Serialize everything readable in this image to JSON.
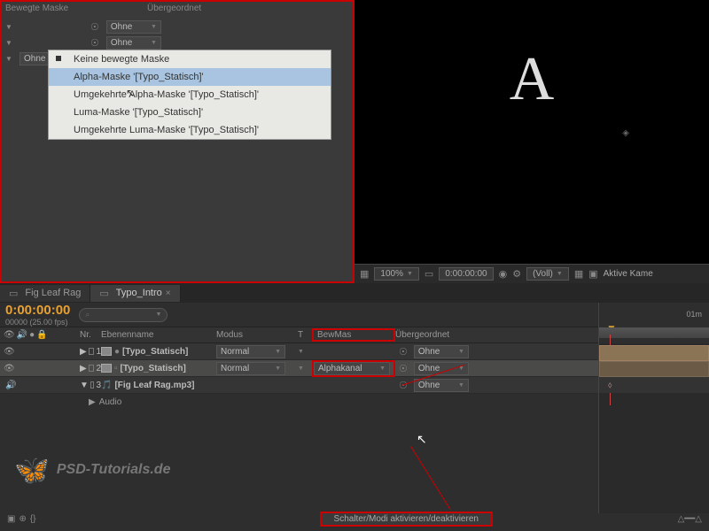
{
  "topPanel": {
    "colHeader1": "Bewegte Maske",
    "colHeader2": "Übergeordnet",
    "none": "Ohne",
    "dropdown": {
      "opt1": "Keine bewegte Maske",
      "opt2": "Alpha-Maske '[Typo_Statisch]'",
      "opt3": "Umgekehrte Alpha-Maske '[Typo_Statisch]'",
      "opt4": "Luma-Maske '[Typo_Statisch]'",
      "opt5": "Umgekehrte Luma-Maske '[Typo_Statisch]'"
    }
  },
  "preview": {
    "letter": "A",
    "zoom": "100%",
    "time": "0:00:00:00",
    "res": "(Voll)",
    "camera": "Aktive Kame"
  },
  "tabs": {
    "tab1": "Fig Leaf Rag",
    "tab2": "Typo_Intro"
  },
  "timeline": {
    "timecode": "0:00:00:00",
    "fps": "00000 (25.00 fps)",
    "search": "⌕",
    "endTime": "01m",
    "headers": {
      "num": "Nr.",
      "name": "Ebenenname",
      "mode": "Modus",
      "t": "T",
      "bewmas": "BewMas",
      "parent": "Übergeordnet"
    },
    "layers": [
      {
        "num": "1",
        "name": "[Typo_Statisch]",
        "mode": "Normal",
        "bewmas": "",
        "parent": "Ohne"
      },
      {
        "num": "2",
        "name": "[Typo_Statisch]",
        "mode": "Normal",
        "bewmas": "Alphakanal",
        "parent": "Ohne"
      },
      {
        "num": "3",
        "name": "[Fig Leaf Rag.mp3]",
        "mode": "",
        "bewmas": "",
        "parent": "Ohne"
      }
    ],
    "audio": "Audio"
  },
  "watermark": "PSD-Tutorials.de",
  "toggleBtn": "Schalter/Modi aktivieren/deaktivieren"
}
